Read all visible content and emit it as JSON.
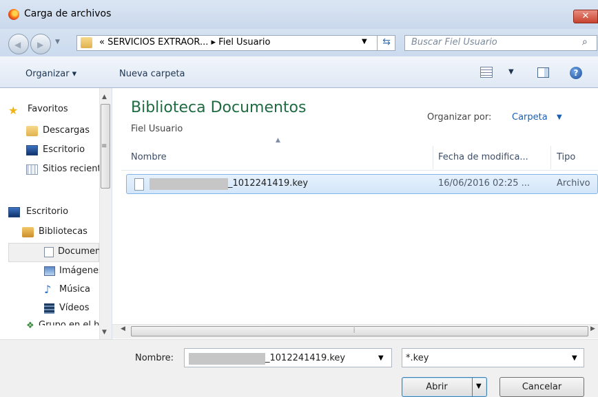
{
  "window": {
    "title": "Carga de archivos",
    "close_label": "✕"
  },
  "address": {
    "overflow": "«",
    "path_part1": "SERVICIOS EXTRAOR...",
    "separator": "▸",
    "path_part2": "Fiel Usuario",
    "search_placeholder": "Buscar Fiel Usuario"
  },
  "toolbar": {
    "organize_label": "Organizar ▾",
    "new_folder_label": "Nueva carpeta"
  },
  "sidebar": {
    "items": [
      {
        "label": "Favoritos",
        "icon": "star-icon"
      },
      {
        "label": "Descargas",
        "icon": "downloads-folder-icon"
      },
      {
        "label": "Escritorio",
        "icon": "desktop-icon"
      },
      {
        "label": "Sitios recientes",
        "icon": "recent-places-icon"
      },
      {
        "label": "Escritorio",
        "icon": "desktop-icon"
      },
      {
        "label": "Bibliotecas",
        "icon": "libraries-icon"
      },
      {
        "label": "Documentos",
        "icon": "documents-icon"
      },
      {
        "label": "Imágenes",
        "icon": "pictures-icon"
      },
      {
        "label": "Música",
        "icon": "music-icon"
      },
      {
        "label": "Vídeos",
        "icon": "videos-icon"
      },
      {
        "label": "Grupo en el hogar",
        "icon": "homegroup-icon"
      }
    ]
  },
  "library": {
    "title": "Biblioteca Documentos",
    "subtitle": "Fiel Usuario",
    "arrange_label": "Organizar por:",
    "arrange_value": "Carpeta"
  },
  "columns": {
    "name": "Nombre",
    "date": "Fecha de modifica...",
    "type": "Tipo"
  },
  "files": [
    {
      "name_suffix": "_1012241419.key",
      "date": "16/06/2016 02:25 ...",
      "type": "Archivo"
    }
  ],
  "footer": {
    "name_label": "Nombre:",
    "name_value": "_1012241419.key",
    "filter_value": "*.key",
    "open_label": "Abrir",
    "cancel_label": "Cancelar"
  },
  "colors": {
    "accent_green": "#1e6b42",
    "selection_border": "#7eb4ea",
    "link_blue": "#1a5fb4"
  }
}
